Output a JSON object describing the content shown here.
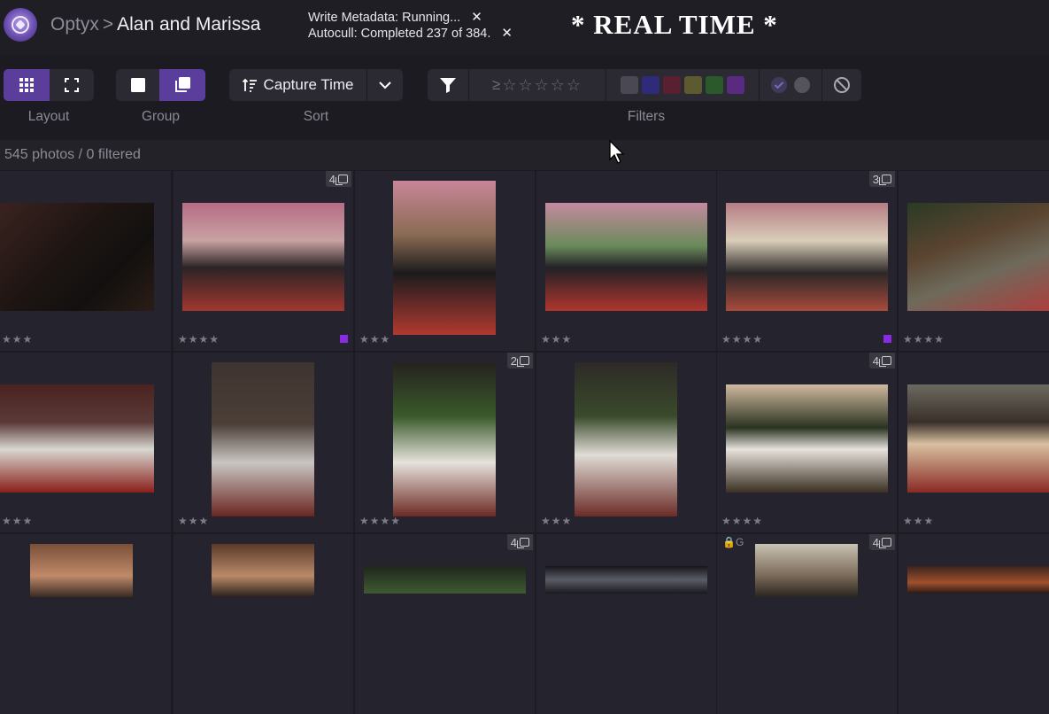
{
  "header": {
    "app_name": "Optyx",
    "breadcrumb_sep": ">",
    "project": "Alan and Marissa",
    "tasks": [
      {
        "text": "Write Metadata: Running...",
        "close": "✕"
      },
      {
        "text": "Autocull: Completed 237 of 384.",
        "close": "✕"
      }
    ],
    "overlay_caption": "* REAL TIME *"
  },
  "toolbar": {
    "layout_label": "Layout",
    "group_label": "Group",
    "sort_label": "Sort",
    "sort_value": "Capture Time",
    "filters_label": "Filters",
    "rating_filter_symbol": "≥",
    "rating_filter_stars": "☆☆☆☆☆",
    "color_filters": [
      "#4a4953",
      "#2f2a7a",
      "#5a1f31",
      "#5c5a30",
      "#2a5a2a",
      "#5a2a80"
    ]
  },
  "status": {
    "text": "545 photos / 0 filtered"
  },
  "grid": {
    "accent_label_color": "#8a2be2",
    "cells": [
      {
        "rating": "★★★",
        "stack": "",
        "label": false,
        "lock": ""
      },
      {
        "rating": "★★★★",
        "stack": "4",
        "label": true,
        "lock": ""
      },
      {
        "rating": "★★★",
        "stack": "",
        "label": false,
        "lock": ""
      },
      {
        "rating": "★★★",
        "stack": "",
        "label": false,
        "lock": ""
      },
      {
        "rating": "★★★★",
        "stack": "3",
        "label": true,
        "lock": ""
      },
      {
        "rating": "★★★★",
        "stack": "",
        "label": false,
        "lock": ""
      },
      {
        "rating": "★★★",
        "stack": "",
        "label": false,
        "lock": ""
      },
      {
        "rating": "★★★",
        "stack": "",
        "label": false,
        "lock": ""
      },
      {
        "rating": "★★★★",
        "stack": "2",
        "label": false,
        "lock": ""
      },
      {
        "rating": "★★★",
        "stack": "",
        "label": false,
        "lock": ""
      },
      {
        "rating": "★★★★",
        "stack": "4",
        "label": false,
        "lock": ""
      },
      {
        "rating": "★★★",
        "stack": "",
        "label": false,
        "lock": ""
      },
      {
        "rating": "",
        "stack": "",
        "label": false,
        "lock": ""
      },
      {
        "rating": "",
        "stack": "",
        "label": false,
        "lock": ""
      },
      {
        "rating": "",
        "stack": "4",
        "label": false,
        "lock": ""
      },
      {
        "rating": "",
        "stack": "",
        "label": false,
        "lock": ""
      },
      {
        "rating": "",
        "stack": "4",
        "label": false,
        "lock": "🔒G"
      },
      {
        "rating": "",
        "stack": "",
        "label": false,
        "lock": ""
      }
    ]
  }
}
